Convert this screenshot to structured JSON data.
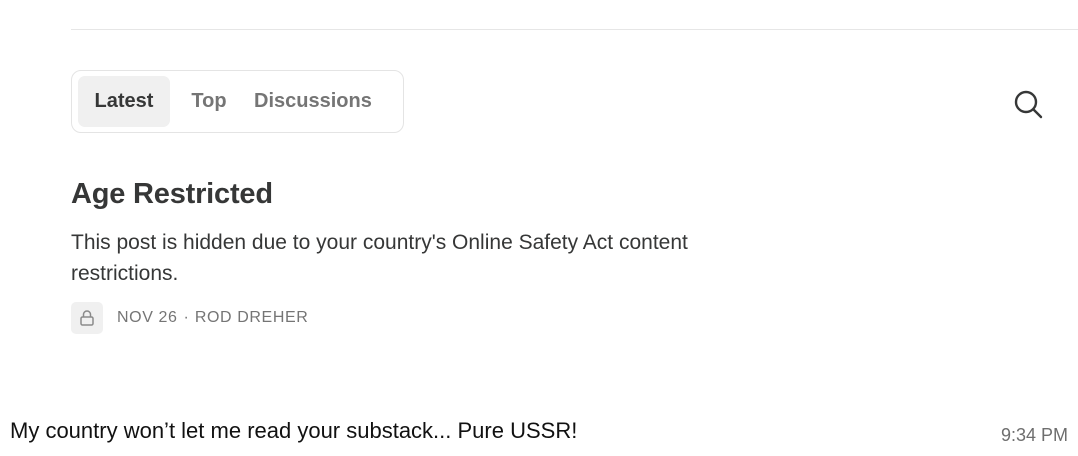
{
  "feed": {
    "tabs": [
      {
        "label": "Latest",
        "active": true
      },
      {
        "label": "Top",
        "active": false
      },
      {
        "label": "Discussions",
        "active": false
      }
    ],
    "search_icon": "search-icon"
  },
  "post": {
    "title": "Age Restricted",
    "body": "This post is hidden due to your country's Online Safety Act content restrictions.",
    "lock_icon": "lock-icon",
    "date": "NOV 26",
    "separator": "·",
    "author": "ROD DREHER"
  },
  "message": {
    "text": "My country won’t let me read your substack... Pure USSR!",
    "time": "9:34 PM"
  }
}
